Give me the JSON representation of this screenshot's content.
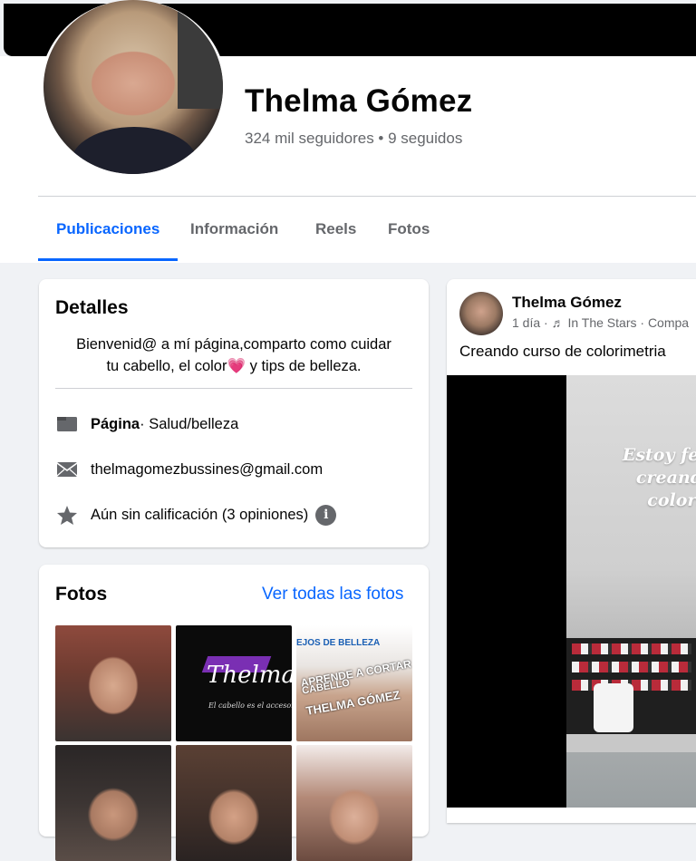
{
  "profile": {
    "name": "Thelma Gómez",
    "followers": "324 mil seguidores • 9 seguidos"
  },
  "tabs": [
    {
      "label": "Publicaciones",
      "active": true
    },
    {
      "label": "Información",
      "active": false
    },
    {
      "label": "Reels",
      "active": false
    },
    {
      "label": "Fotos",
      "active": false
    }
  ],
  "details": {
    "title": "Detalles",
    "bio_line1": "Bienvenid@ a mí página,comparto como cuidar",
    "bio_line2_a": "tu cabello, el color",
    "bio_emoji": "💗",
    "bio_line2_b": "y tips de belleza.",
    "page_label": "Página",
    "page_category": " · Salud/belleza",
    "email": "thelmagomezbussines@gmail.com",
    "rating": "Aún sin calificación (3 opiniones)",
    "info_icon_glyph": "i"
  },
  "photos": {
    "title": "Fotos",
    "see_all": "Ver todas las fotos",
    "tile2_text": "Thelma G",
    "tile2_sub": "El cabello es el accesorio m",
    "tile3_line1": "EJOS DE BELLEZA",
    "tile3_line2": "APRENDE A CORTAR",
    "tile3_line3": "CABELLO",
    "tile3_line4": "THELMA GÓMEZ"
  },
  "post": {
    "author": "Thelma Gómez",
    "time": "1 día",
    "music": "In The Stars",
    "meta_rest": "· Compa",
    "text": "Creando curso de colorimetria",
    "overlay_line1": "Estoy feliz, p",
    "overlay_line2": "creando n",
    "overlay_line3": "colorim"
  },
  "colors": {
    "accent": "#0866ff",
    "secondary_text": "#65676b",
    "background": "#f0f2f5"
  }
}
